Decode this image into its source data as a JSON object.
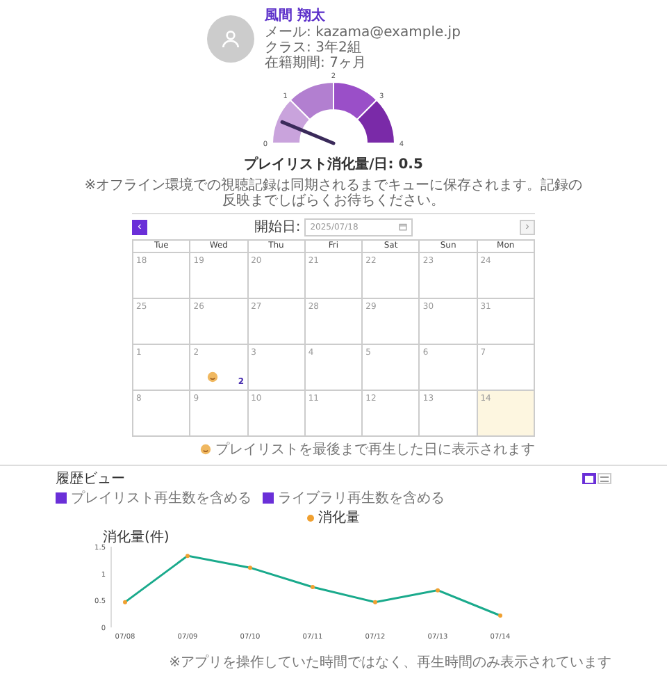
{
  "profile": {
    "name": "風間 翔太",
    "lines": [
      "メール: kazama@example.jp",
      "クラス: 3年2組",
      "在籍期間: 7ヶ月"
    ]
  },
  "gauge": {
    "ticks": [
      "0",
      "1",
      "2",
      "3",
      "4"
    ],
    "label": "プレイリスト消化量/日: 0.5"
  },
  "notice": "※オフライン環境での視聴記録は同期されるまでキューに保存されます。記録の反映までしばらくお待ちください。",
  "calendar": {
    "prev": "‹",
    "next": "›",
    "date_label": "開始日:",
    "date_value": "2025/07/18",
    "weekdays": [
      "Tue",
      "Wed",
      "Thu",
      "Fri",
      "Sat",
      "Sun",
      "Mon"
    ],
    "weeks": [
      [
        {
          "day": "18",
          "today": false,
          "played": false
        },
        {
          "day": "19",
          "today": false,
          "played": false
        },
        {
          "day": "20",
          "today": false,
          "played": false
        },
        {
          "day": "21",
          "today": false,
          "played": false
        },
        {
          "day": "22",
          "today": false,
          "played": false
        },
        {
          "day": "23",
          "today": false,
          "played": false
        },
        {
          "day": "24",
          "today": false,
          "played": false
        }
      ],
      [
        {
          "day": "25",
          "today": false,
          "played": false
        },
        {
          "day": "26",
          "today": false,
          "played": false
        },
        {
          "day": "27",
          "today": false,
          "played": false
        },
        {
          "day": "28",
          "today": false,
          "played": false
        },
        {
          "day": "29",
          "today": false,
          "played": false
        },
        {
          "day": "30",
          "today": false,
          "played": false
        },
        {
          "day": "31",
          "today": false,
          "played": false
        }
      ],
      [
        {
          "day": "1",
          "today": false,
          "played": false
        },
        {
          "day": "2",
          "today": false,
          "played": true,
          "count": "2"
        },
        {
          "day": "3",
          "today": false,
          "played": false
        },
        {
          "day": "4",
          "today": false,
          "played": false
        },
        {
          "day": "5",
          "today": false,
          "played": false
        },
        {
          "day": "6",
          "today": false,
          "played": false
        },
        {
          "day": "7",
          "today": false,
          "played": false
        }
      ],
      [
        {
          "day": "8",
          "today": false,
          "played": false
        },
        {
          "day": "9",
          "today": false,
          "played": false
        },
        {
          "day": "10",
          "today": false,
          "played": false
        },
        {
          "day": "11",
          "today": false,
          "played": false
        },
        {
          "day": "12",
          "today": false,
          "played": false
        },
        {
          "day": "13",
          "today": false,
          "played": false
        },
        {
          "day": "14",
          "today": true,
          "played": false
        }
      ]
    ],
    "legend": "プレイリストを最後まで再生した日に表示されます"
  },
  "history": {
    "title": "履歴ビュー",
    "views": [
      {
        "kind": "chart",
        "selected": true
      },
      {
        "kind": "list",
        "selected": false
      }
    ],
    "filters": [
      {
        "label": "プレイリスト再生数を含める",
        "checked": true
      },
      {
        "label": "ライブラリ再生数を含める",
        "checked": true
      }
    ],
    "chart_data": {
      "type": "line",
      "ylabel": "消化量(件)",
      "categories": [
        "07/08",
        "07/09",
        "07/10",
        "07/11",
        "07/12",
        "07/13",
        "07/14"
      ],
      "series": [
        {
          "name": "消化量",
          "color": "#1aaa8c",
          "marker": "circle",
          "values": [
            0.47,
            1.33,
            1.11,
            0.75,
            0.47,
            0.69,
            0.22
          ]
        }
      ],
      "ylim": [
        0,
        1.5
      ],
      "yticks": [
        0,
        0.5,
        1,
        1.5
      ]
    },
    "footnote": "※アプリを操作していた時間ではなく、再生時間のみ表示されています"
  }
}
